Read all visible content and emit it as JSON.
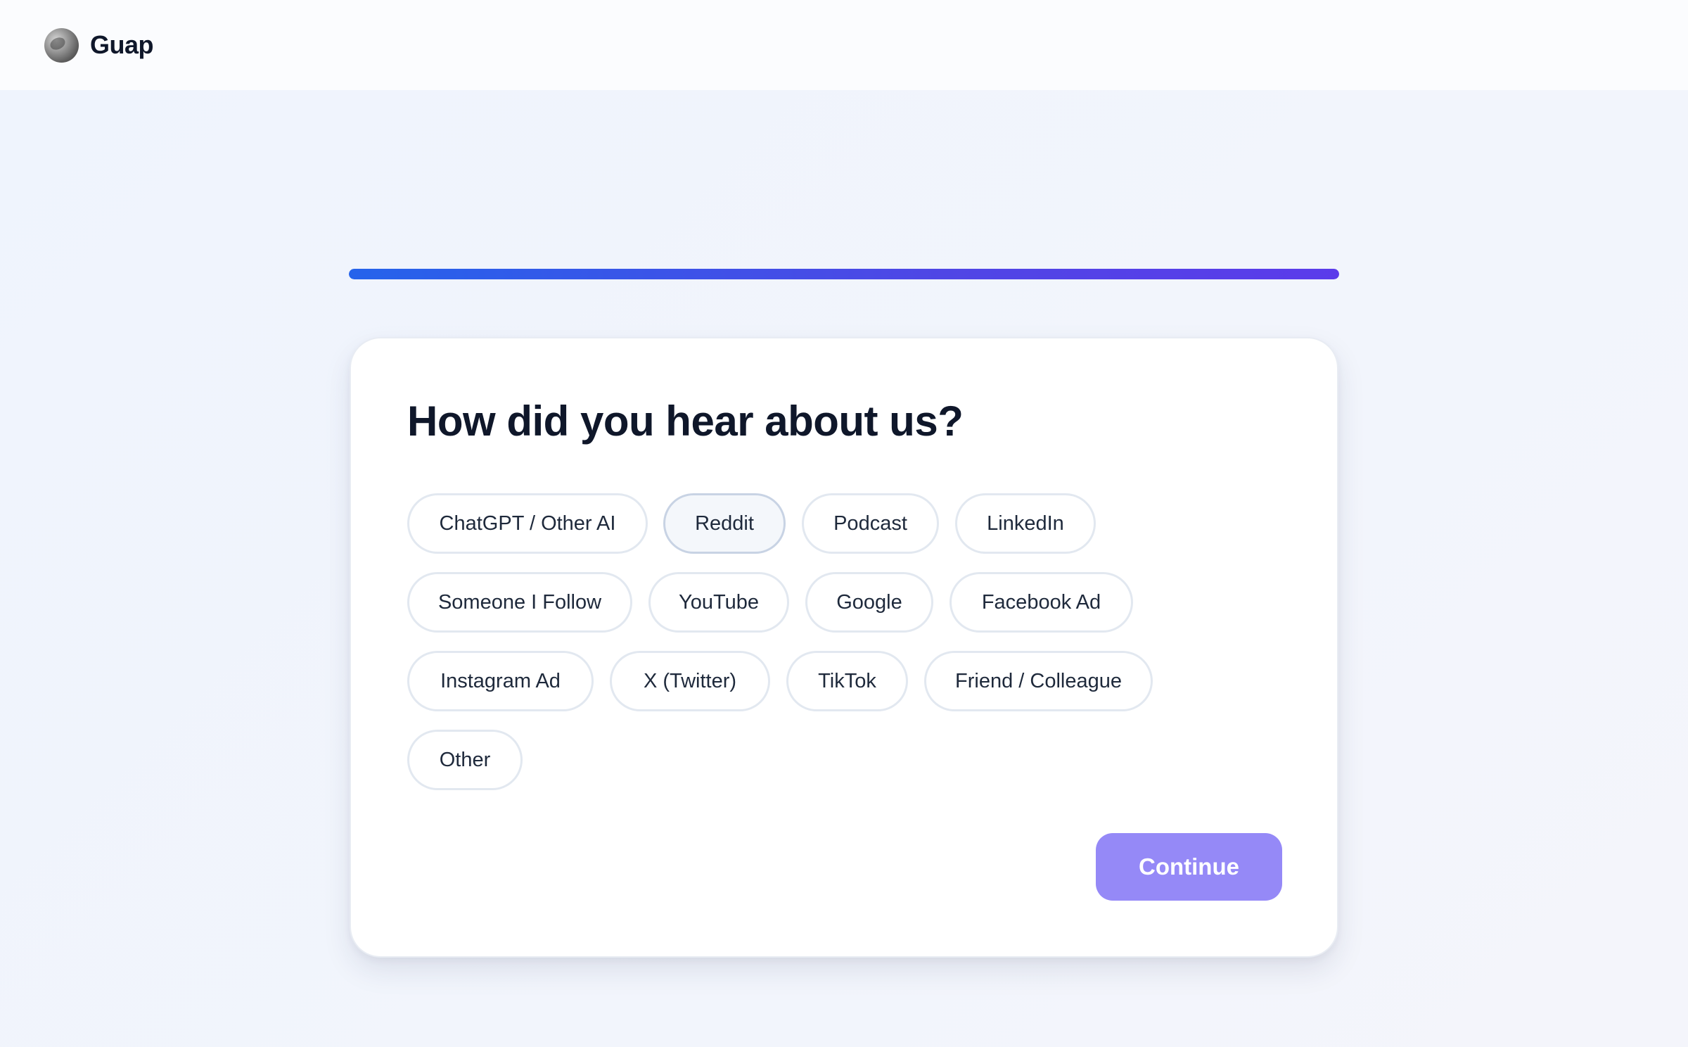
{
  "header": {
    "brand_name": "Guap",
    "logo_icon": "globe-logo-icon"
  },
  "progress": {
    "value_percent": 100,
    "colors": [
      "#2563eb",
      "#5b3bea"
    ]
  },
  "card": {
    "question": "How did you hear about us?",
    "options": [
      "ChatGPT / Other AI",
      "Reddit",
      "Podcast",
      "LinkedIn",
      "Someone I Follow",
      "YouTube",
      "Google",
      "Facebook Ad",
      "Instagram Ad",
      "X (Twitter)",
      "TikTok",
      "Friend / Colleague",
      "Other"
    ],
    "hovered_option": "Reddit",
    "continue_label": "Continue",
    "continue_color": "#9589f7"
  }
}
